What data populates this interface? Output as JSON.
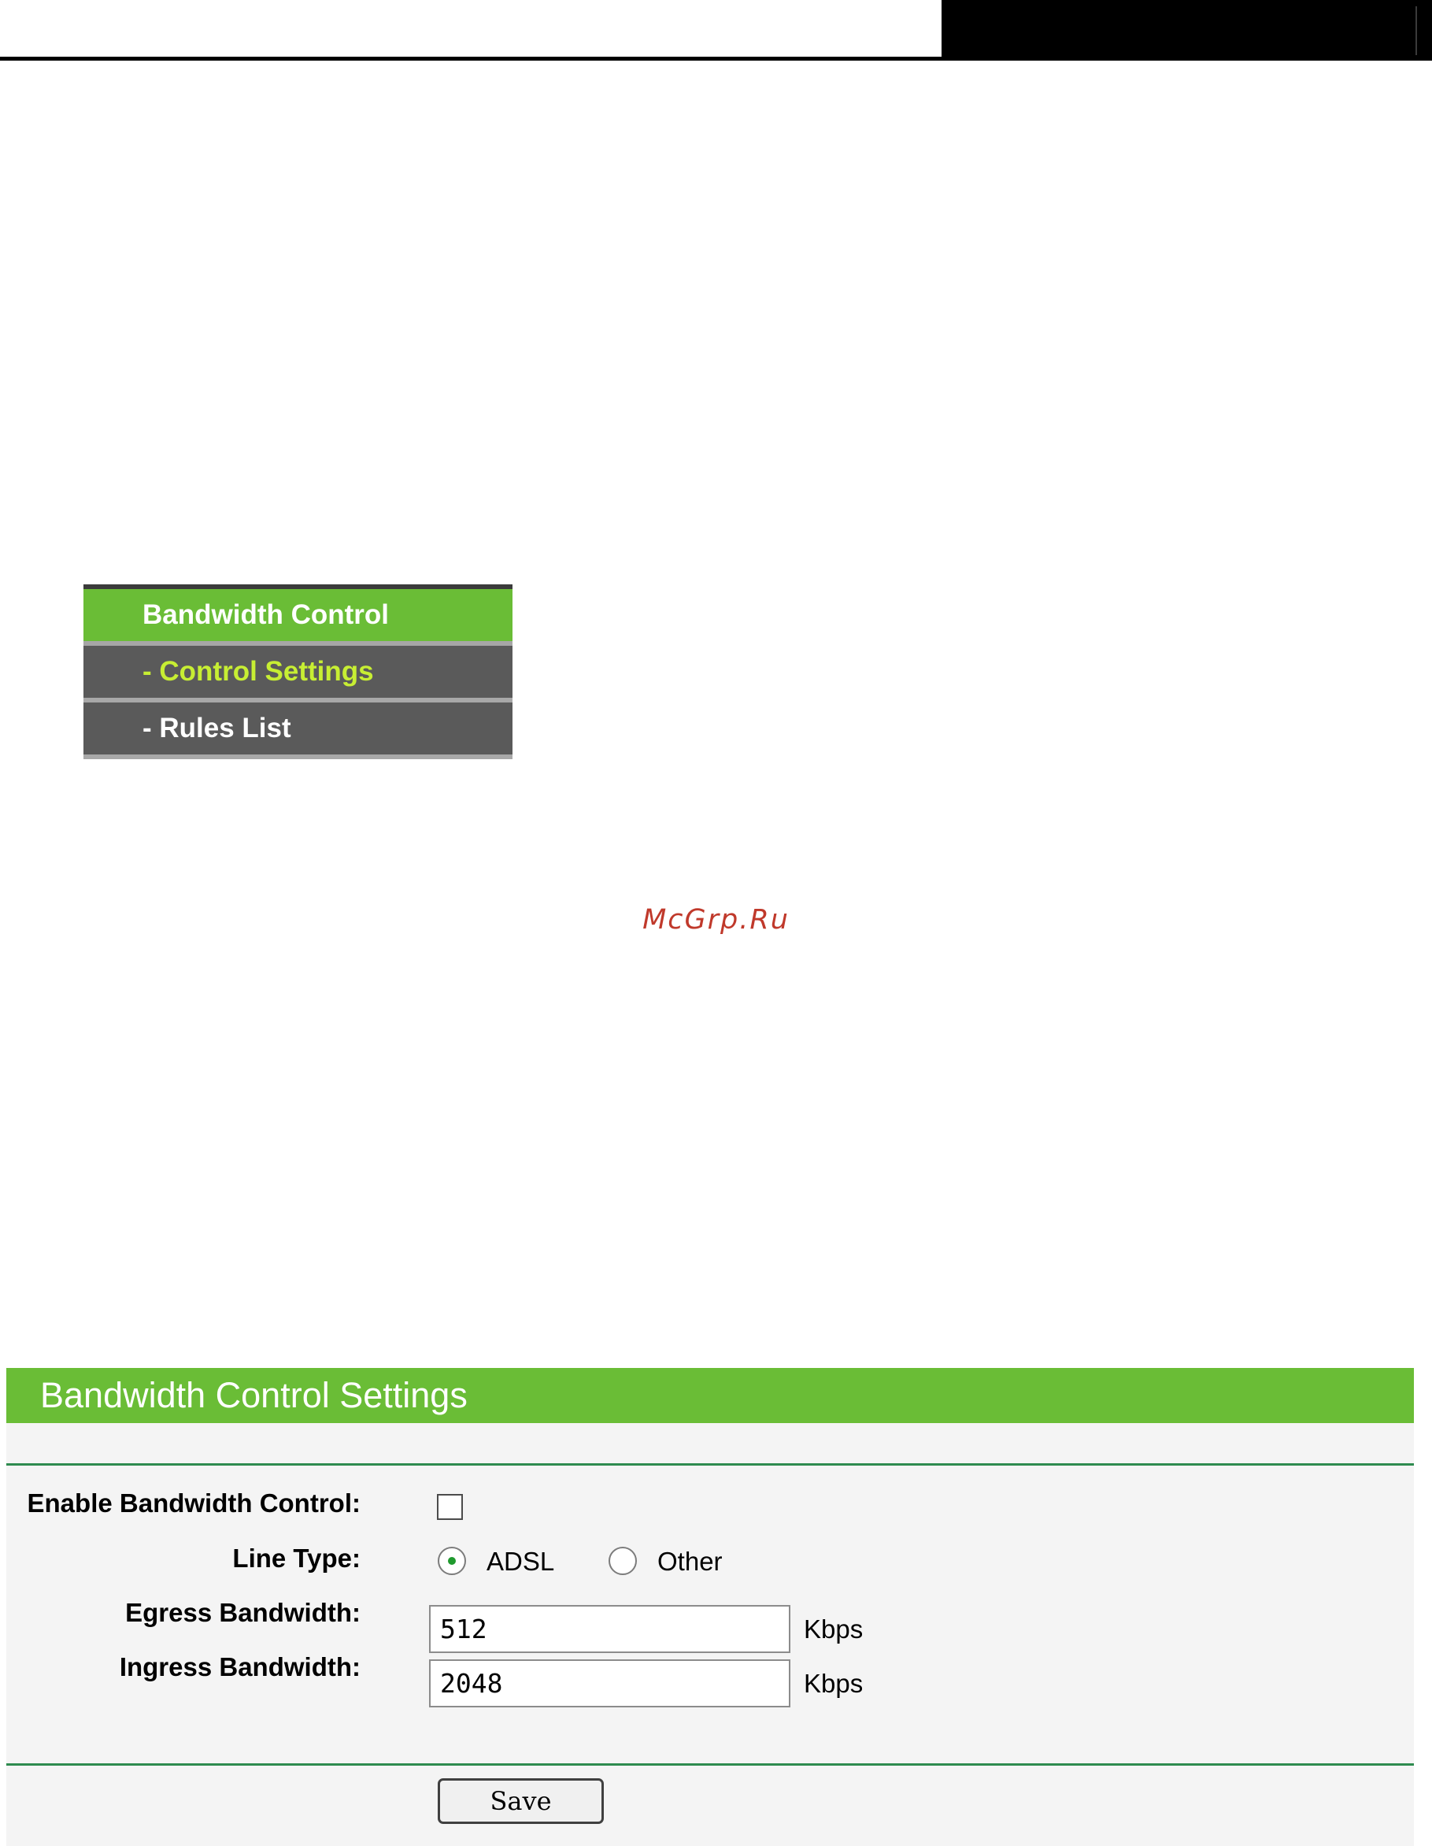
{
  "menu": {
    "header": "Bandwidth Control",
    "items": [
      {
        "label": "- Control Settings",
        "active": true
      },
      {
        "label": "- Rules List",
        "active": false
      }
    ]
  },
  "watermark": "McGrp.Ru",
  "panel": {
    "title": "Bandwidth Control Settings",
    "enable_label": "Enable Bandwidth Control:",
    "enable_checked": false,
    "line_type_label": "Line Type:",
    "line_type_options": [
      {
        "label": "ADSL",
        "selected": true
      },
      {
        "label": "Other",
        "selected": false
      }
    ],
    "egress_label": "Egress Bandwidth:",
    "egress_value": "512",
    "egress_unit": "Kbps",
    "ingress_label": "Ingress Bandwidth:",
    "ingress_value": "2048",
    "ingress_unit": "Kbps",
    "save_label": "Save"
  },
  "colors": {
    "accent_green": "#6abd36",
    "menu_gray": "#5a5a5a",
    "active_menu_text": "#c7ee33",
    "divider_green": "#2e8b4f"
  }
}
